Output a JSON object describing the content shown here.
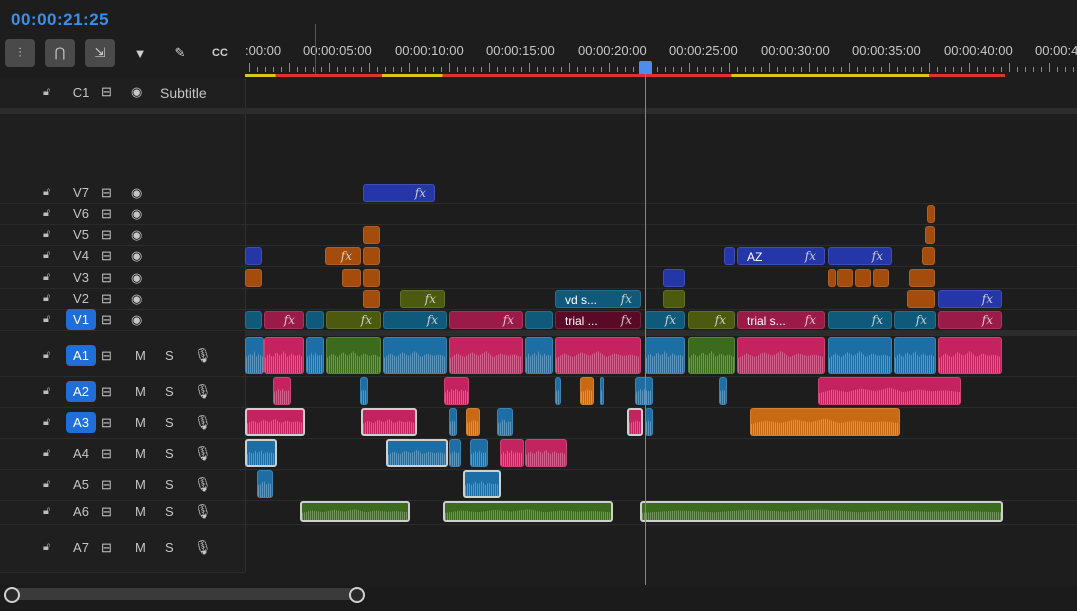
{
  "timecode": "00:00:21:25",
  "toolbar": [
    {
      "name": "insert-sequence-nest-icon",
      "glyph": "⫶",
      "on": true
    },
    {
      "name": "snap-magnet-icon",
      "glyph": "⋂",
      "on": true
    },
    {
      "name": "linked-selection-icon",
      "glyph": "⇲",
      "on": true
    },
    {
      "name": "add-marker-icon",
      "glyph": "▼",
      "on": false
    },
    {
      "name": "wrench-settings-icon",
      "glyph": "🔧",
      "on": false
    },
    {
      "name": "captions-cc-icon",
      "glyph": "CC",
      "on": false
    }
  ],
  "ruler_labels": [
    ":00:00",
    "00:00:05:00",
    "00:00:10:00",
    "00:00:15:00",
    "00:00:20:00",
    "00:00:25:00",
    "00:00:30:00",
    "00:00:35:00",
    "00:00:40:00",
    "00:00:4"
  ],
  "tracks": {
    "caption": {
      "name": "C1",
      "label": "Subtitle"
    },
    "video": [
      "V7",
      "V6",
      "V5",
      "V4",
      "V3",
      "V2",
      "V1"
    ],
    "audio": [
      "A1",
      "A2",
      "A3",
      "A4",
      "A5",
      "A6",
      "A7"
    ],
    "mute_label": "M",
    "solo_label": "S"
  },
  "clip_text": {
    "fx": "fx",
    "v4_az": "AZ",
    "v2_vd": "vd s...",
    "v1_trial1": "trial ...",
    "v1_trial2": "trial s..."
  },
  "colors": {
    "accent": "#3b8eea",
    "video_blue": "#2536a8",
    "video_orange": "#a34c0c",
    "video_olive": "#4b5a0e",
    "video_teal": "#0f5a7a",
    "video_pink": "#9a1a48",
    "audio_blue": "#1c6ea5",
    "audio_pink": "#c3245f",
    "audio_orange": "#c86a14",
    "audio_green": "#3c6b1e"
  }
}
